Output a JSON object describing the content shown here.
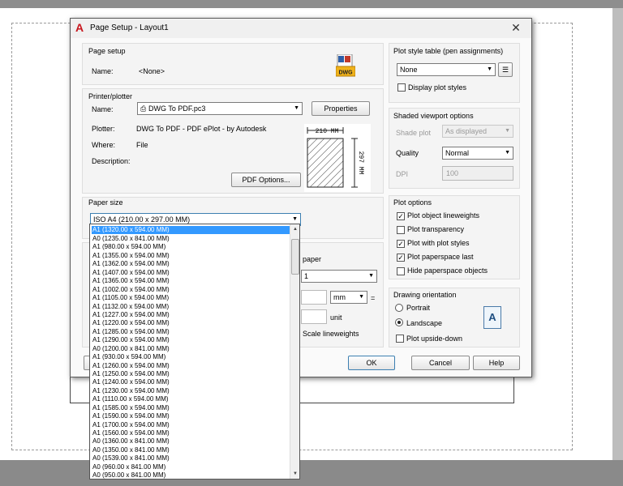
{
  "dialog": {
    "title": "Page Setup - Layout1",
    "close_glyph": "✕",
    "app_icon": "autocad-a-icon"
  },
  "page_setup": {
    "title": "Page setup",
    "name_label": "Name:",
    "name_value": "<None>",
    "icon": "dwg-file-icon",
    "icon_text": "DWG"
  },
  "printer": {
    "title": "Printer/plotter",
    "name_label": "Name:",
    "name_value": "DWG To PDF.pc3",
    "properties_label": "Properties",
    "plotter_label": "Plotter:",
    "plotter_value": "DWG To PDF - PDF ePlot - by Autodesk",
    "where_label": "Where:",
    "where_value": "File",
    "description_label": "Description:",
    "pdf_options_label": "PDF Options...",
    "preview_width": "210 MM",
    "preview_height": "297 MM"
  },
  "paper_size": {
    "title": "Paper size",
    "selected": "ISO A4 (210.00 x 297.00 MM)",
    "options": [
      "A1 (1320.00 x 594.00 MM)",
      "A0 (1235.00 x 841.00 MM)",
      "A1 (980.00 x 594.00 MM)",
      "A1 (1355.00 x 594.00 MM)",
      "A1 (1362.00 x 594.00 MM)",
      "A1 (1407.00 x 594.00 MM)",
      "A1 (1365.00 x 594.00 MM)",
      "A1 (1002.00 x 594.00 MM)",
      "A1 (1105.00 x 594.00 MM)",
      "A1 (1132.00 x 594.00 MM)",
      "A1 (1227.00 x 594.00 MM)",
      "A1 (1220.00 x 594.00 MM)",
      "A1 (1285.00 x 594.00 MM)",
      "A1 (1290.00 x 594.00 MM)",
      "A0 (1200.00 x 841.00 MM)",
      "A1 (930.00 x 594.00 MM)",
      "A1 (1260.00 x 594.00 MM)",
      "A1 (1250.00 x 594.00 MM)",
      "A1 (1240.00 x 594.00 MM)",
      "A1 (1230.00 x 594.00 MM)",
      "A1 (1110.00 x 594.00 MM)",
      "A1 (1585.00 x 594.00 MM)",
      "A1 (1590.00 x 594.00 MM)",
      "A1 (1700.00 x 594.00 MM)",
      "A1 (1560.00 x 594.00 MM)",
      "A0 (1360.00 x 841.00 MM)",
      "A0 (1350.00 x 841.00 MM)",
      "A0 (1539.00 x 841.00 MM)",
      "A0 (960.00 x 841.00 MM)",
      "A0 (950.00 x 841.00 MM)"
    ],
    "selected_index": 0
  },
  "partial": {
    "paper_text": "paper",
    "scale_value": "1",
    "unit_value": "mm",
    "equals": "=",
    "unit_label": "unit",
    "scale_lineweights": "Scale lineweights"
  },
  "plot_style": {
    "title": "Plot style table (pen assignments)",
    "value": "None",
    "edit_icon": "edit-plot-style-icon",
    "display_label": "Display plot styles",
    "display_checked": false
  },
  "shaded": {
    "title": "Shaded viewport options",
    "shade_label": "Shade plot",
    "shade_value": "As displayed",
    "quality_label": "Quality",
    "quality_value": "Normal",
    "dpi_label": "DPI",
    "dpi_value": "100"
  },
  "plot_options": {
    "title": "Plot options",
    "items": [
      {
        "label": "Plot object lineweights",
        "checked": true
      },
      {
        "label": "Plot transparency",
        "checked": false
      },
      {
        "label": "Plot with plot styles",
        "checked": true
      },
      {
        "label": "Plot paperspace last",
        "checked": true
      },
      {
        "label": "Hide paperspace objects",
        "checked": false
      }
    ]
  },
  "orientation": {
    "title": "Drawing orientation",
    "portrait": "Portrait",
    "landscape": "Landscape",
    "selected": "Landscape",
    "upside_down": "Plot upside-down",
    "upside_down_checked": false,
    "icon": "landscape-orientation-icon",
    "icon_glyph": "A"
  },
  "buttons": {
    "ok": "OK",
    "cancel": "Cancel",
    "help": "Help"
  }
}
